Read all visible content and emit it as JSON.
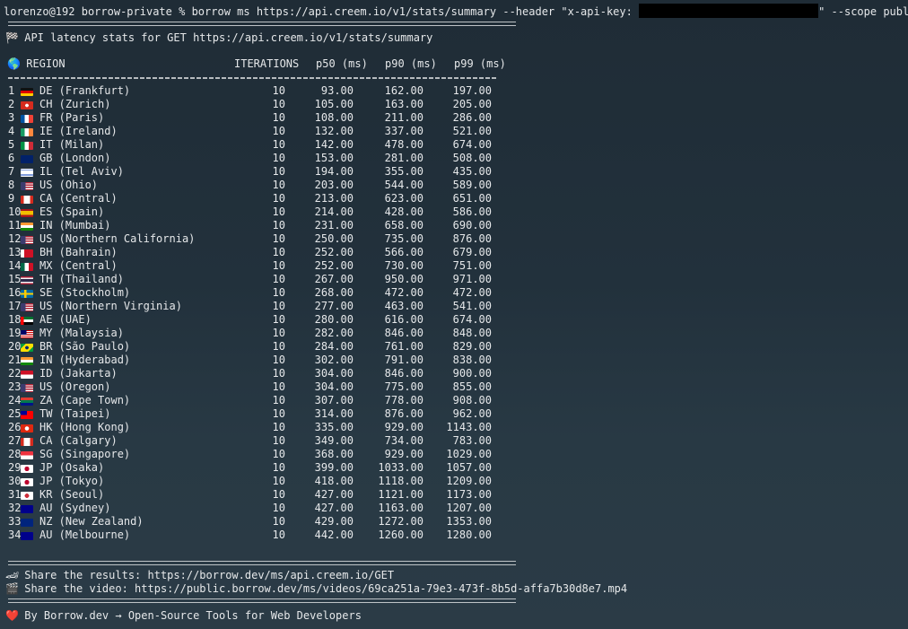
{
  "prompt": {
    "user_host": "lorenzo@192",
    "cwd": "borrow-private",
    "symbol": "%",
    "command_before": "borrow ms https://api.creem.io/v1/stats/summary --header \"x-api-key: ",
    "command_after": "\" --scope public"
  },
  "title": {
    "icon": "🏁",
    "text": "API latency stats for GET https://api.creem.io/v1/stats/summary"
  },
  "headers": {
    "icon": "🌎",
    "region": "REGION",
    "iterations": "ITERATIONS",
    "p50": "p50 (ms)",
    "p90": "p90 (ms)",
    "p99": "p99 (ms)"
  },
  "rows": [
    {
      "n": "1",
      "code": "DE",
      "flag": "de",
      "region": "DE (Frankfurt)",
      "it": "10",
      "p50": "93.00",
      "p90": "162.00",
      "p99": "197.00"
    },
    {
      "n": "2",
      "code": "CH",
      "flag": "ch",
      "region": "CH (Zurich)",
      "it": "10",
      "p50": "105.00",
      "p90": "163.00",
      "p99": "205.00"
    },
    {
      "n": "3",
      "code": "FR",
      "flag": "fr",
      "region": "FR (Paris)",
      "it": "10",
      "p50": "108.00",
      "p90": "211.00",
      "p99": "286.00"
    },
    {
      "n": "4",
      "code": "IE",
      "flag": "ie",
      "region": "IE (Ireland)",
      "it": "10",
      "p50": "132.00",
      "p90": "337.00",
      "p99": "521.00"
    },
    {
      "n": "5",
      "code": "IT",
      "flag": "it",
      "region": "IT (Milan)",
      "it": "10",
      "p50": "142.00",
      "p90": "478.00",
      "p99": "674.00"
    },
    {
      "n": "6",
      "code": "GB",
      "flag": "gb",
      "region": "GB (London)",
      "it": "10",
      "p50": "153.00",
      "p90": "281.00",
      "p99": "508.00"
    },
    {
      "n": "7",
      "code": "IL",
      "flag": "il",
      "region": "IL (Tel Aviv)",
      "it": "10",
      "p50": "194.00",
      "p90": "355.00",
      "p99": "435.00"
    },
    {
      "n": "8",
      "code": "US",
      "flag": "us",
      "region": "US (Ohio)",
      "it": "10",
      "p50": "203.00",
      "p90": "544.00",
      "p99": "589.00"
    },
    {
      "n": "9",
      "code": "CA",
      "flag": "ca",
      "region": "CA (Central)",
      "it": "10",
      "p50": "213.00",
      "p90": "623.00",
      "p99": "651.00"
    },
    {
      "n": "10",
      "code": "ES",
      "flag": "es",
      "region": "ES (Spain)",
      "it": "10",
      "p50": "214.00",
      "p90": "428.00",
      "p99": "586.00"
    },
    {
      "n": "11",
      "code": "IN",
      "flag": "in",
      "region": "IN (Mumbai)",
      "it": "10",
      "p50": "231.00",
      "p90": "658.00",
      "p99": "690.00"
    },
    {
      "n": "12",
      "code": "US",
      "flag": "us",
      "region": "US (Northern California)",
      "it": "10",
      "p50": "250.00",
      "p90": "735.00",
      "p99": "876.00"
    },
    {
      "n": "13",
      "code": "BH",
      "flag": "bh",
      "region": "BH (Bahrain)",
      "it": "10",
      "p50": "252.00",
      "p90": "566.00",
      "p99": "679.00"
    },
    {
      "n": "14",
      "code": "MX",
      "flag": "mx",
      "region": "MX (Central)",
      "it": "10",
      "p50": "252.00",
      "p90": "730.00",
      "p99": "751.00"
    },
    {
      "n": "15",
      "code": "TH",
      "flag": "th",
      "region": "TH (Thailand)",
      "it": "10",
      "p50": "267.00",
      "p90": "950.00",
      "p99": "971.00"
    },
    {
      "n": "16",
      "code": "SE",
      "flag": "se",
      "region": "SE (Stockholm)",
      "it": "10",
      "p50": "268.00",
      "p90": "472.00",
      "p99": "472.00"
    },
    {
      "n": "17",
      "code": "US",
      "flag": "us",
      "region": "US (Northern Virginia)",
      "it": "10",
      "p50": "277.00",
      "p90": "463.00",
      "p99": "541.00"
    },
    {
      "n": "18",
      "code": "AE",
      "flag": "ae",
      "region": "AE (UAE)",
      "it": "10",
      "p50": "280.00",
      "p90": "616.00",
      "p99": "674.00"
    },
    {
      "n": "19",
      "code": "MY",
      "flag": "my",
      "region": "MY (Malaysia)",
      "it": "10",
      "p50": "282.00",
      "p90": "846.00",
      "p99": "848.00"
    },
    {
      "n": "20",
      "code": "BR",
      "flag": "br",
      "region": "BR (São Paulo)",
      "it": "10",
      "p50": "284.00",
      "p90": "761.00",
      "p99": "829.00"
    },
    {
      "n": "21",
      "code": "IN",
      "flag": "in",
      "region": "IN (Hyderabad)",
      "it": "10",
      "p50": "302.00",
      "p90": "791.00",
      "p99": "838.00"
    },
    {
      "n": "22",
      "code": "ID",
      "flag": "id",
      "region": "ID (Jakarta)",
      "it": "10",
      "p50": "304.00",
      "p90": "846.00",
      "p99": "900.00"
    },
    {
      "n": "23",
      "code": "US",
      "flag": "us",
      "region": "US (Oregon)",
      "it": "10",
      "p50": "304.00",
      "p90": "775.00",
      "p99": "855.00"
    },
    {
      "n": "24",
      "code": "ZA",
      "flag": "za",
      "region": "ZA (Cape Town)",
      "it": "10",
      "p50": "307.00",
      "p90": "778.00",
      "p99": "908.00"
    },
    {
      "n": "25",
      "code": "TW",
      "flag": "tw",
      "region": "TW (Taipei)",
      "it": "10",
      "p50": "314.00",
      "p90": "876.00",
      "p99": "962.00"
    },
    {
      "n": "26",
      "code": "HK",
      "flag": "hk",
      "region": "HK (Hong Kong)",
      "it": "10",
      "p50": "335.00",
      "p90": "929.00",
      "p99": "1143.00"
    },
    {
      "n": "27",
      "code": "CA",
      "flag": "ca",
      "region": "CA (Calgary)",
      "it": "10",
      "p50": "349.00",
      "p90": "734.00",
      "p99": "783.00"
    },
    {
      "n": "28",
      "code": "SG",
      "flag": "sg",
      "region": "SG (Singapore)",
      "it": "10",
      "p50": "368.00",
      "p90": "929.00",
      "p99": "1029.00"
    },
    {
      "n": "29",
      "code": "JP",
      "flag": "jp",
      "region": "JP (Osaka)",
      "it": "10",
      "p50": "399.00",
      "p90": "1033.00",
      "p99": "1057.00"
    },
    {
      "n": "30",
      "code": "JP",
      "flag": "jp",
      "region": "JP (Tokyo)",
      "it": "10",
      "p50": "418.00",
      "p90": "1118.00",
      "p99": "1209.00"
    },
    {
      "n": "31",
      "code": "KR",
      "flag": "kr",
      "region": "KR (Seoul)",
      "it": "10",
      "p50": "427.00",
      "p90": "1121.00",
      "p99": "1173.00"
    },
    {
      "n": "32",
      "code": "AU",
      "flag": "au",
      "region": "AU (Sydney)",
      "it": "10",
      "p50": "427.00",
      "p90": "1163.00",
      "p99": "1207.00"
    },
    {
      "n": "33",
      "code": "NZ",
      "flag": "nz",
      "region": "NZ (New Zealand)",
      "it": "10",
      "p50": "429.00",
      "p90": "1272.00",
      "p99": "1353.00"
    },
    {
      "n": "34",
      "code": "AU",
      "flag": "au",
      "region": "AU (Melbourne)",
      "it": "10",
      "p50": "442.00",
      "p90": "1260.00",
      "p99": "1280.00"
    }
  ],
  "share": {
    "results_icon": "🏎",
    "results_text": "Share the results: https://borrow.dev/ms/api.creem.io/GET",
    "video_icon": "🎬",
    "video_text": "Share the video: https://public.borrow.dev/ms/videos/69ca251a-79e3-473f-8b5d-affa7b30d8e7.mp4"
  },
  "footer": {
    "icon": "❤️",
    "text": "By Borrow.dev → Open-Source Tools for Web Developers"
  },
  "colors": {
    "background": "#22313c",
    "text": "#e6e8ea",
    "redaction": "#000000"
  }
}
